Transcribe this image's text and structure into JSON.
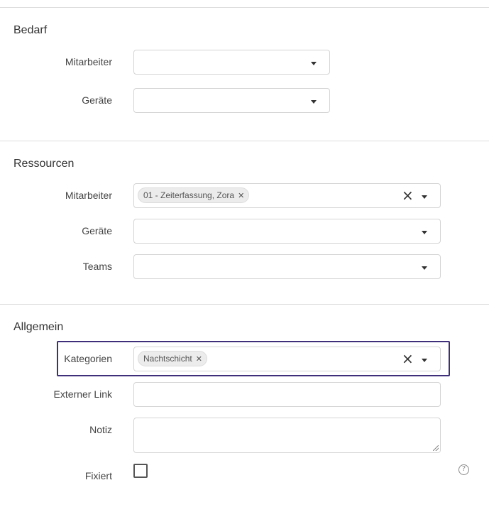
{
  "bedarf": {
    "title": "Bedarf",
    "mitarbeiter_label": "Mitarbeiter",
    "geraete_label": "Geräte"
  },
  "ressourcen": {
    "title": "Ressourcen",
    "mitarbeiter_label": "Mitarbeiter",
    "mitarbeiter_chip": "01 - Zeiterfassung, Zora",
    "geraete_label": "Geräte",
    "teams_label": "Teams"
  },
  "allgemein": {
    "title": "Allgemein",
    "kategorien_label": "Kategorien",
    "kategorien_chip": "Nachtschicht",
    "externer_link_label": "Externer Link",
    "notiz_label": "Notiz",
    "fixiert_label": "Fixiert"
  },
  "icons": {
    "clear": "close-icon",
    "dropdown": "caret-down-icon",
    "chip_remove": "chip-remove-icon",
    "help": "help-circle-icon"
  },
  "colors": {
    "highlight_border": "#3f2f7a",
    "chip_bg": "#ececec"
  }
}
